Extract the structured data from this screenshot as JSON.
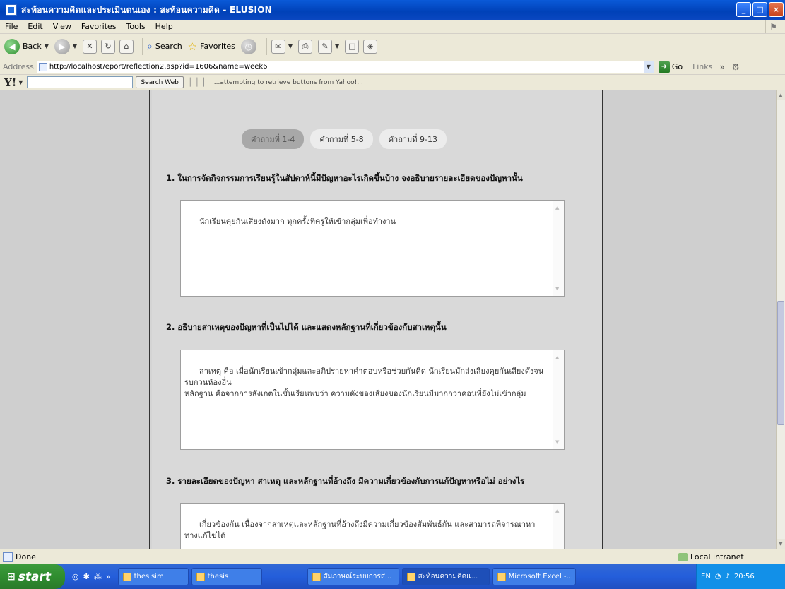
{
  "window": {
    "title": "สะท้อนความคิดและประเมินตนเอง : สะท้อนความคิด - ELUSION",
    "controls": [
      "_",
      "□",
      "×"
    ]
  },
  "menu": [
    "File",
    "Edit",
    "View",
    "Favorites",
    "Tools",
    "Help"
  ],
  "toolbar": {
    "back": "Back",
    "search": "Search",
    "favorites": "Favorites"
  },
  "address": {
    "label": "Address",
    "url": "http://localhost/eport/reflection2.asp?id=1606&name=week6",
    "go": "Go",
    "links": "Links"
  },
  "yahoo": {
    "logo": "Y!",
    "search_button": "Search Web",
    "status": "...attempting to retrieve buttons from Yahoo!..."
  },
  "tabs": [
    "คำถามที่ 1-4",
    "คำถามที่ 5-8",
    "คำถามที่ 9-13"
  ],
  "questions": [
    {
      "q": "1. ในการจัดกิจกรรมการเรียนรู้ในสัปดาห์นี้มีปัญหาอะไรเกิดขึ้นบ้าง จงอธิบายรายละเอียดของปัญหานั้น",
      "a": "นักเรียนคุยกันเสียงดังมาก ทุกครั้งที่ครูให้เข้ากลุ่มเพื่อทำงาน"
    },
    {
      "q": "2. อธิบายสาเหตุของปัญหาที่เป็นไปได้ และแสดงหลักฐานที่เกี่ยวข้องกับสาเหตุนั้น",
      "a": "สาเหตุ คือ เมื่อนักเรียนเข้ากลุ่มและอภิปรายหาคำตอบหรือช่วยกันคิด นักเรียนมักส่งเสียงคุยกันเสียงดังจนรบกวนห้องอื่น\nหลักฐาน คือจากการสังเกตในชั้นเรียนพบว่า ความดังของเสียงของนักเรียนมีมากกว่าคอนที่ยังไม่เข้ากลุ่ม"
    },
    {
      "q": "3. รายละเอียดของปัญหา สาเหตุ และหลักฐานที่อ้างถึง มีความเกี่ยวข้องกับการแก้ปัญหาหรือไม่ อย่างไร",
      "a": "เกี่ยวข้องกัน เนื่องจากสาเหตุและหลักฐานที่อ้างถึงมีความเกี่ยวข้องสัมพันธ์กัน และสามารถพิจารณาหาทางแก้ไขได้"
    }
  ],
  "status": {
    "left": "Done",
    "zone": "Local intranet"
  },
  "taskbar": {
    "start": "start",
    "tasks": [
      "thesisim",
      "thesis",
      "สัมภาษณ์ระบบการส...",
      "สะท้อนความคิดแ...",
      "Microsoft Excel -..."
    ],
    "tray": {
      "lang": "EN",
      "time": "20:56"
    }
  }
}
